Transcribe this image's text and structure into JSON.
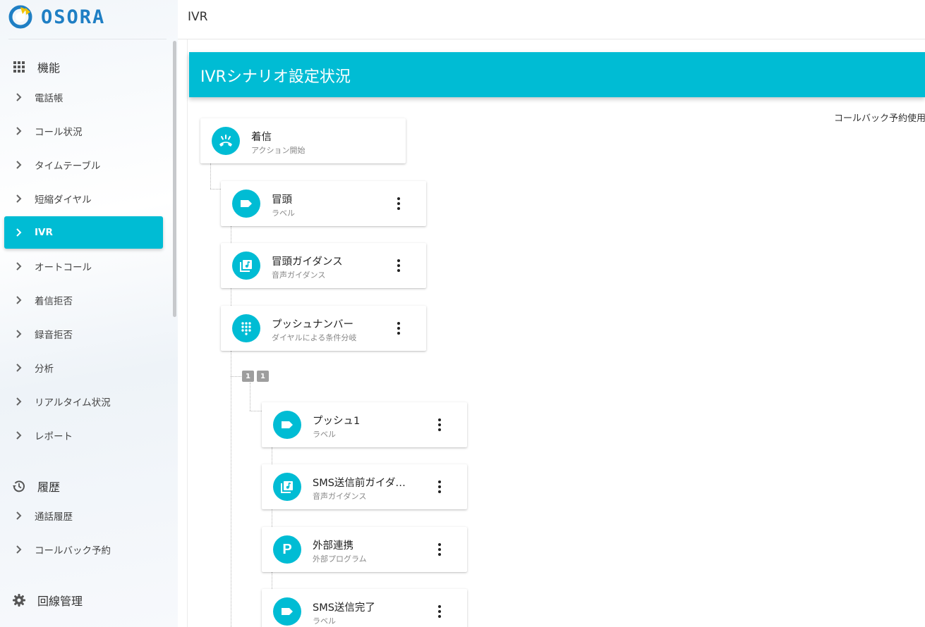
{
  "app": {
    "logo_text": "OSORA"
  },
  "topbar": {
    "title": "IVR"
  },
  "sidebar": {
    "groups": [
      {
        "label": "機能",
        "icon": "grid-icon"
      },
      {
        "label": "履歴",
        "icon": "history-icon"
      },
      {
        "label": "回線管理",
        "icon": "gear-icon"
      }
    ],
    "features": [
      "電話帳",
      "コール状況",
      "タイムテーブル",
      "短縮ダイヤル",
      "IVR",
      "オートコール",
      "着信拒否",
      "録音拒否",
      "分析",
      "リアルタイム状況",
      "レポート"
    ],
    "history": [
      "通話履歴",
      "コールバック予約"
    ],
    "active_item": "IVR"
  },
  "main": {
    "banner_title": "IVRシナリオ設定状況",
    "callback_status": "コールバック予約使用"
  },
  "tree": {
    "root": {
      "title": "着信",
      "subtitle": "アクション開始",
      "icon": "incoming-call-icon"
    },
    "nodes": [
      {
        "title": "冒頭",
        "subtitle": "ラベル",
        "icon": "label-icon"
      },
      {
        "title": "冒頭ガイダンス",
        "subtitle": "音声ガイダンス",
        "icon": "audio-guidance-icon"
      },
      {
        "title": "プッシュナンバー",
        "subtitle": "ダイヤルによる条件分岐",
        "icon": "dialpad-icon"
      }
    ],
    "branch_badges": [
      "1",
      "1"
    ],
    "branch_nodes": [
      {
        "title": "プッシュ1",
        "subtitle": "ラベル",
        "icon": "label-icon"
      },
      {
        "title": "SMS送信前ガイダ…",
        "subtitle": "音声ガイダンス",
        "icon": "audio-guidance-icon"
      },
      {
        "title": "外部連携",
        "subtitle": "外部プログラム",
        "icon": "external-program-icon",
        "icon_letter": "P"
      },
      {
        "title": "SMS送信完了",
        "subtitle": "ラベル",
        "icon": "label-icon"
      }
    ]
  }
}
